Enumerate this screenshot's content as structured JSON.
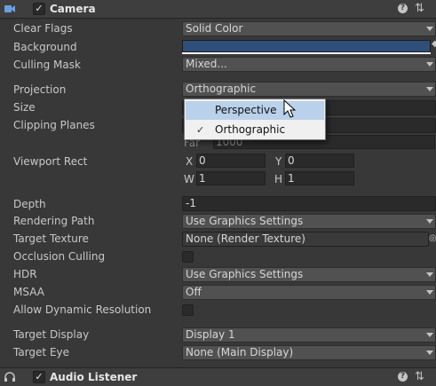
{
  "camera_header": {
    "title": "Camera",
    "enabled": "✓",
    "help": "?",
    "settings": "⇅"
  },
  "rows": {
    "clear_flags": {
      "label": "Clear Flags",
      "value": "Solid Color"
    },
    "background": {
      "label": "Background",
      "color": "#2f4f7a"
    },
    "culling_mask": {
      "label": "Culling Mask",
      "value": "Mixed..."
    },
    "projection": {
      "label": "Projection",
      "value": "Orthographic"
    },
    "size": {
      "label": "Size"
    },
    "clipping_planes": {
      "label": "Clipping Planes",
      "far_label": "Far",
      "far_value": "1000"
    },
    "viewport_rect": {
      "label": "Viewport Rect",
      "x_label": "X",
      "x_value": "0",
      "y_label": "Y",
      "y_value": "0",
      "w_label": "W",
      "w_value": "1",
      "h_label": "H",
      "h_value": "1"
    },
    "depth": {
      "label": "Depth",
      "value": "-1"
    },
    "rendering_path": {
      "label": "Rendering Path",
      "value": "Use Graphics Settings"
    },
    "target_texture": {
      "label": "Target Texture",
      "value": "None (Render Texture)"
    },
    "occlusion_culling": {
      "label": "Occlusion Culling"
    },
    "hdr": {
      "label": "HDR",
      "value": "Use Graphics Settings"
    },
    "msaa": {
      "label": "MSAA",
      "value": "Off"
    },
    "allow_dynamic_resolution": {
      "label": "Allow Dynamic Resolution"
    },
    "target_display": {
      "label": "Target Display",
      "value": "Display 1"
    },
    "target_eye": {
      "label": "Target Eye",
      "value": "None (Main Display)"
    }
  },
  "projection_popup": {
    "options": [
      {
        "label": "Perspective",
        "checked": ""
      },
      {
        "label": "Orthographic",
        "checked": "✓"
      }
    ]
  },
  "audio_header": {
    "title": "Audio Listener",
    "enabled": "✓",
    "help": "?",
    "settings": "⇅"
  }
}
